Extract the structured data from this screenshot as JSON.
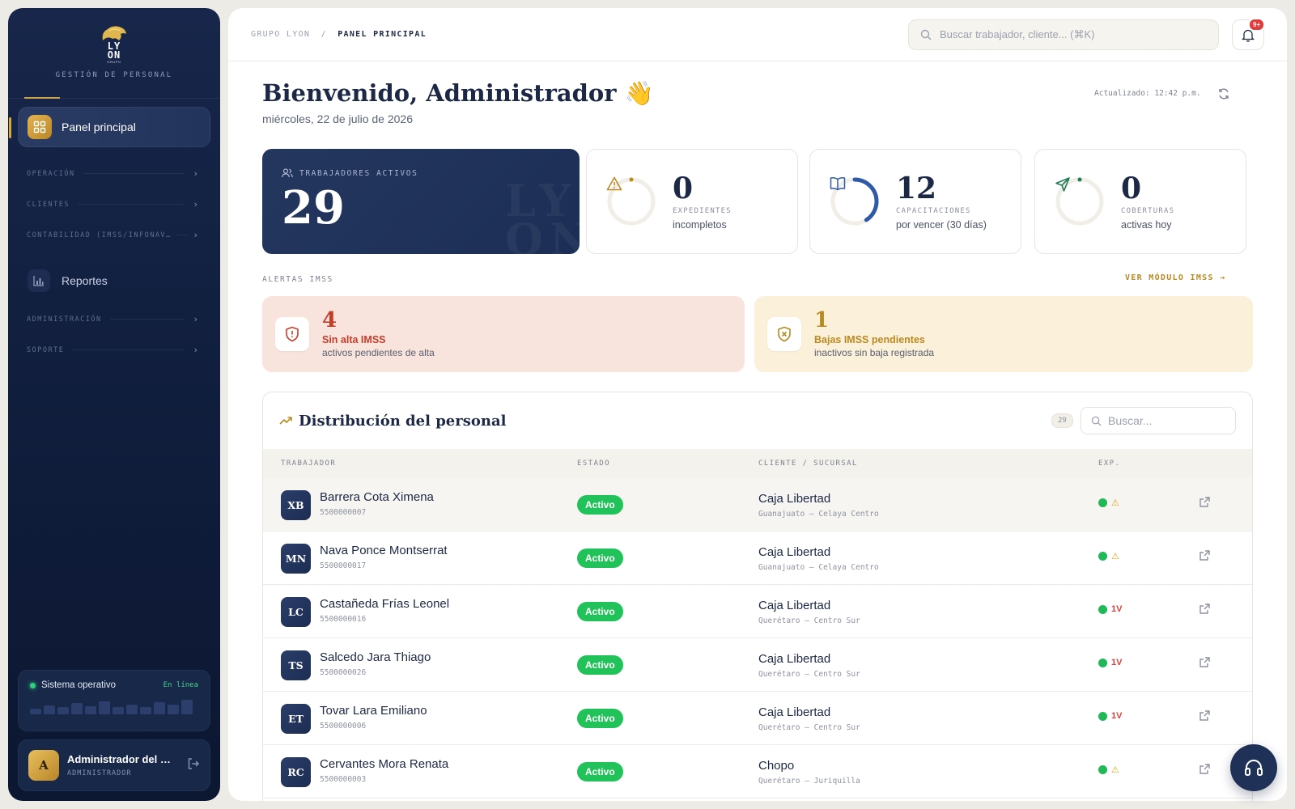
{
  "sidebar": {
    "brand_top": "LY",
    "brand_bottom": "ON",
    "brand_small": "GRUPO",
    "brand_sub": "GESTIÓN DE PERSONAL",
    "active_item": "Panel principal",
    "sections": [
      {
        "label": "OPERACIÓN",
        "chevron": "›"
      },
      {
        "label": "CLIENTES",
        "chevron": "›"
      },
      {
        "label": "CONTABILIDAD (IMSS/INFONAV…",
        "chevron": "›"
      },
      {
        "label": "ADMINISTRACIÓN",
        "chevron": "›"
      },
      {
        "label": "SOPORTE",
        "chevron": "›"
      }
    ],
    "reports_item": "Reportes",
    "status": {
      "label": "Sistema operativo",
      "state": "En línea",
      "bars": [
        0.35,
        0.55,
        0.45,
        0.7,
        0.5,
        0.8,
        0.45,
        0.6,
        0.45,
        0.75,
        0.6,
        0.9
      ]
    },
    "user": {
      "initial": "A",
      "name": "Administrador del Sistema",
      "role": "ADMINISTRADOR",
      "logout_icon": "logout-icon"
    }
  },
  "topbar": {
    "breadcrumb_root": "GRUPO LYON",
    "breadcrumb_sep": "/",
    "breadcrumb_current": "PANEL PRINCIPAL",
    "search_placeholder": "Buscar trabajador, cliente... (⌘K)",
    "notifications": "9+"
  },
  "welcome": {
    "title": "Bienvenido, Administrador",
    "emoji": "👋",
    "date": "miércoles, 22 de julio de 2026",
    "updated": "Actualizado: 12:42 p.m."
  },
  "kpis": {
    "main": {
      "label": "TRABAJADORES ACTIVOS",
      "value": "29"
    },
    "cards": [
      {
        "value": "0",
        "label1": "EXPEDIENTES",
        "label2": "incompletos",
        "icon": "warning-icon",
        "progress": 0,
        "color": "#b98a22"
      },
      {
        "value": "12",
        "label1": "CAPACITACIONES",
        "label2": "por vencer (30 días)",
        "icon": "book-icon",
        "progress": 0.41,
        "color": "#2f5aa8"
      },
      {
        "value": "0",
        "label1": "COBERTURAS",
        "label2": "activas hoy",
        "icon": "send-icon",
        "progress": 0,
        "color": "#1f7a55"
      }
    ]
  },
  "alerts": {
    "label": "ALERTAS IMSS",
    "link": "VER MÓDULO IMSS →",
    "items": [
      {
        "count": "4",
        "title": "Sin alta IMSS",
        "subtitle": "activos pendientes de alta",
        "bg": "#f9e3dd",
        "color": "#c33f2b"
      },
      {
        "count": "1",
        "title": "Bajas IMSS pendientes",
        "subtitle": "inactivos sin baja registrada",
        "bg": "#fbf0d9",
        "color": "#b98a22"
      }
    ]
  },
  "distribution": {
    "title": "Distribución del personal",
    "count": "29",
    "search_placeholder": "Buscar...",
    "columns": [
      "TRABAJADOR",
      "ESTADO",
      "CLIENTE / SUCURSAL",
      "EXP."
    ],
    "rows": [
      {
        "initials": "XB",
        "name": "Barrera Cota Ximena",
        "id": "5500000007",
        "status": "Activo",
        "client": "Caja Libertad",
        "branch": "Guanajuato — Celaya Centro",
        "exp": "warn"
      },
      {
        "initials": "MN",
        "name": "Nava Ponce Montserrat",
        "id": "5500000017",
        "status": "Activo",
        "client": "Caja Libertad",
        "branch": "Guanajuato — Celaya Centro",
        "exp": "warn"
      },
      {
        "initials": "LC",
        "name": "Castañeda Frías Leonel",
        "id": "5500000016",
        "status": "Activo",
        "client": "Caja Libertad",
        "branch": "Querétaro — Centro Sur",
        "exp": "1V"
      },
      {
        "initials": "TS",
        "name": "Salcedo Jara Thiago",
        "id": "5500000026",
        "status": "Activo",
        "client": "Caja Libertad",
        "branch": "Querétaro — Centro Sur",
        "exp": "1V"
      },
      {
        "initials": "ET",
        "name": "Tovar Lara Emiliano",
        "id": "5500000006",
        "status": "Activo",
        "client": "Caja Libertad",
        "branch": "Querétaro — Centro Sur",
        "exp": "1V"
      },
      {
        "initials": "RC",
        "name": "Cervantes Mora Renata",
        "id": "5500000003",
        "status": "Activo",
        "client": "Chopo",
        "branch": "Querétaro — Juriquilla",
        "exp": "warn"
      }
    ]
  }
}
